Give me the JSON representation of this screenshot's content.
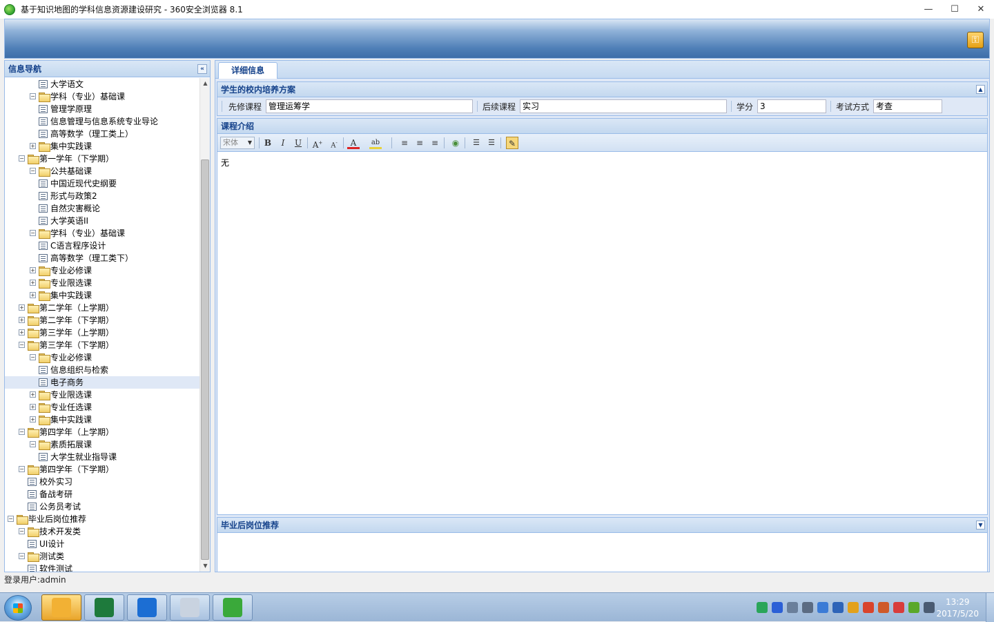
{
  "window": {
    "title": "基于知识地图的学科信息资源建设研究 - 360安全浏览器 8.1",
    "controls": [
      "—",
      "☐",
      "✕"
    ]
  },
  "nav": {
    "title": "信息导航",
    "collapse_glyph": "«",
    "tree": [
      {
        "label": "大学语文",
        "level": 4,
        "kind": "leaf"
      },
      {
        "label": "学科（专业）基础课",
        "level": 3,
        "kind": "folder",
        "expander": "⊟"
      },
      {
        "label": "管理学原理",
        "level": 4,
        "kind": "leaf"
      },
      {
        "label": "信息管理与信息系统专业导论",
        "level": 4,
        "kind": "leaf"
      },
      {
        "label": "高等数学（理工类上）",
        "level": 4,
        "kind": "leaf"
      },
      {
        "label": "集中实践课",
        "level": 3,
        "kind": "folder",
        "expander": "⊞"
      },
      {
        "label": "第一学年（下学期）",
        "level": 2,
        "kind": "folder",
        "expander": "⊟"
      },
      {
        "label": "公共基础课",
        "level": 3,
        "kind": "folder",
        "expander": "⊟"
      },
      {
        "label": "中国近现代史纲要",
        "level": 4,
        "kind": "leaf"
      },
      {
        "label": "形式与政策2",
        "level": 4,
        "kind": "leaf"
      },
      {
        "label": "自然灾害概论",
        "level": 4,
        "kind": "leaf"
      },
      {
        "label": "大学英语II",
        "level": 4,
        "kind": "leaf"
      },
      {
        "label": "学科（专业）基础课",
        "level": 3,
        "kind": "folder",
        "expander": "⊟"
      },
      {
        "label": "C语言程序设计",
        "level": 4,
        "kind": "leaf"
      },
      {
        "label": "高等数学（理工类下）",
        "level": 4,
        "kind": "leaf"
      },
      {
        "label": "专业必修课",
        "level": 3,
        "kind": "folder",
        "expander": "⊞"
      },
      {
        "label": "专业限选课",
        "level": 3,
        "kind": "folder",
        "expander": "⊞"
      },
      {
        "label": "集中实践课",
        "level": 3,
        "kind": "folder",
        "expander": "⊞"
      },
      {
        "label": "第二学年（上学期）",
        "level": 2,
        "kind": "folder",
        "expander": "⊞"
      },
      {
        "label": "第二学年（下学期）",
        "level": 2,
        "kind": "folder",
        "expander": "⊞"
      },
      {
        "label": "第三学年（上学期）",
        "level": 2,
        "kind": "folder",
        "expander": "⊞"
      },
      {
        "label": "第三学年（下学期）",
        "level": 2,
        "kind": "folder",
        "expander": "⊟"
      },
      {
        "label": "专业必修课",
        "level": 3,
        "kind": "folder",
        "expander": "⊟"
      },
      {
        "label": "信息组织与检索",
        "level": 4,
        "kind": "leaf"
      },
      {
        "label": "电子商务",
        "level": 4,
        "kind": "leaf",
        "selected": true
      },
      {
        "label": "专业限选课",
        "level": 3,
        "kind": "folder",
        "expander": "⊞"
      },
      {
        "label": "专业任选课",
        "level": 3,
        "kind": "folder",
        "expander": "⊞"
      },
      {
        "label": "集中实践课",
        "level": 3,
        "kind": "folder",
        "expander": "⊞"
      },
      {
        "label": "第四学年（上学期）",
        "level": 2,
        "kind": "folder",
        "expander": "⊟"
      },
      {
        "label": "素质拓展课",
        "level": 3,
        "kind": "folder",
        "expander": "⊟"
      },
      {
        "label": "大学生就业指导课",
        "level": 4,
        "kind": "leaf"
      },
      {
        "label": "第四学年（下学期）",
        "level": 2,
        "kind": "folder",
        "expander": "⊟"
      },
      {
        "label": "校外实习",
        "level": 3,
        "kind": "leaf"
      },
      {
        "label": "备战考研",
        "level": 3,
        "kind": "leaf"
      },
      {
        "label": "公务员考试",
        "level": 3,
        "kind": "leaf"
      },
      {
        "label": "毕业后岗位推荐",
        "level": 1,
        "kind": "folder",
        "expander": "⊟"
      },
      {
        "label": "技术开发类",
        "level": 2,
        "kind": "folder",
        "expander": "⊟"
      },
      {
        "label": "UI设计",
        "level": 3,
        "kind": "leaf"
      },
      {
        "label": "测试类",
        "level": 2,
        "kind": "folder",
        "expander": "⊟"
      },
      {
        "label": "软件测试",
        "level": 3,
        "kind": "leaf"
      }
    ]
  },
  "status": {
    "login_user": "登录用户:admin"
  },
  "tabs": [
    {
      "label": "详细信息"
    }
  ],
  "plan": {
    "title": "学生的校内培养方案",
    "prereq_label": "先修课程",
    "prereq_value": "管理运筹学",
    "followup_label": "后续课程",
    "followup_value": "实习",
    "credit_label": "学分",
    "credit_value": "3",
    "exam_label": "考试方式",
    "exam_value": "考查"
  },
  "intro": {
    "title": "课程介绍",
    "font_select": "宋体",
    "content": "无"
  },
  "jobs": {
    "title": "毕业后岗位推荐"
  },
  "taskbar": {
    "clock_time": "13:29",
    "clock_date": "2017/5/20",
    "apps": [
      {
        "name": "qq-penguin-app",
        "color": "#f2b134",
        "active": true
      },
      {
        "name": "excel-app",
        "color": "#1e7a3c"
      },
      {
        "name": "teamviewer-app",
        "color": "#1c6ed3"
      },
      {
        "name": "tools-app",
        "color": "#c9d3e0"
      },
      {
        "name": "browser-360-app",
        "color": "#3aa93a"
      }
    ],
    "tray": [
      {
        "name": "sogou-icon",
        "color": "#2aa55a"
      },
      {
        "name": "help-icon",
        "color": "#2b5fd6"
      },
      {
        "name": "arrow-icon",
        "color": "#6a7f9b"
      },
      {
        "name": "network-icon",
        "color": "#5b6b82"
      },
      {
        "name": "user-icon",
        "color": "#3b7bd6"
      },
      {
        "name": "grid-icon",
        "color": "#2e64b8"
      },
      {
        "name": "qq-icon",
        "color": "#e3a11c"
      },
      {
        "name": "game-icon",
        "color": "#d9442c"
      },
      {
        "name": "game2-icon",
        "color": "#cf5a2a"
      },
      {
        "name": "b-icon",
        "color": "#d83c3c"
      },
      {
        "name": "360-icon",
        "color": "#5aa82a"
      },
      {
        "name": "pin-icon",
        "color": "#4a5b72"
      }
    ]
  }
}
